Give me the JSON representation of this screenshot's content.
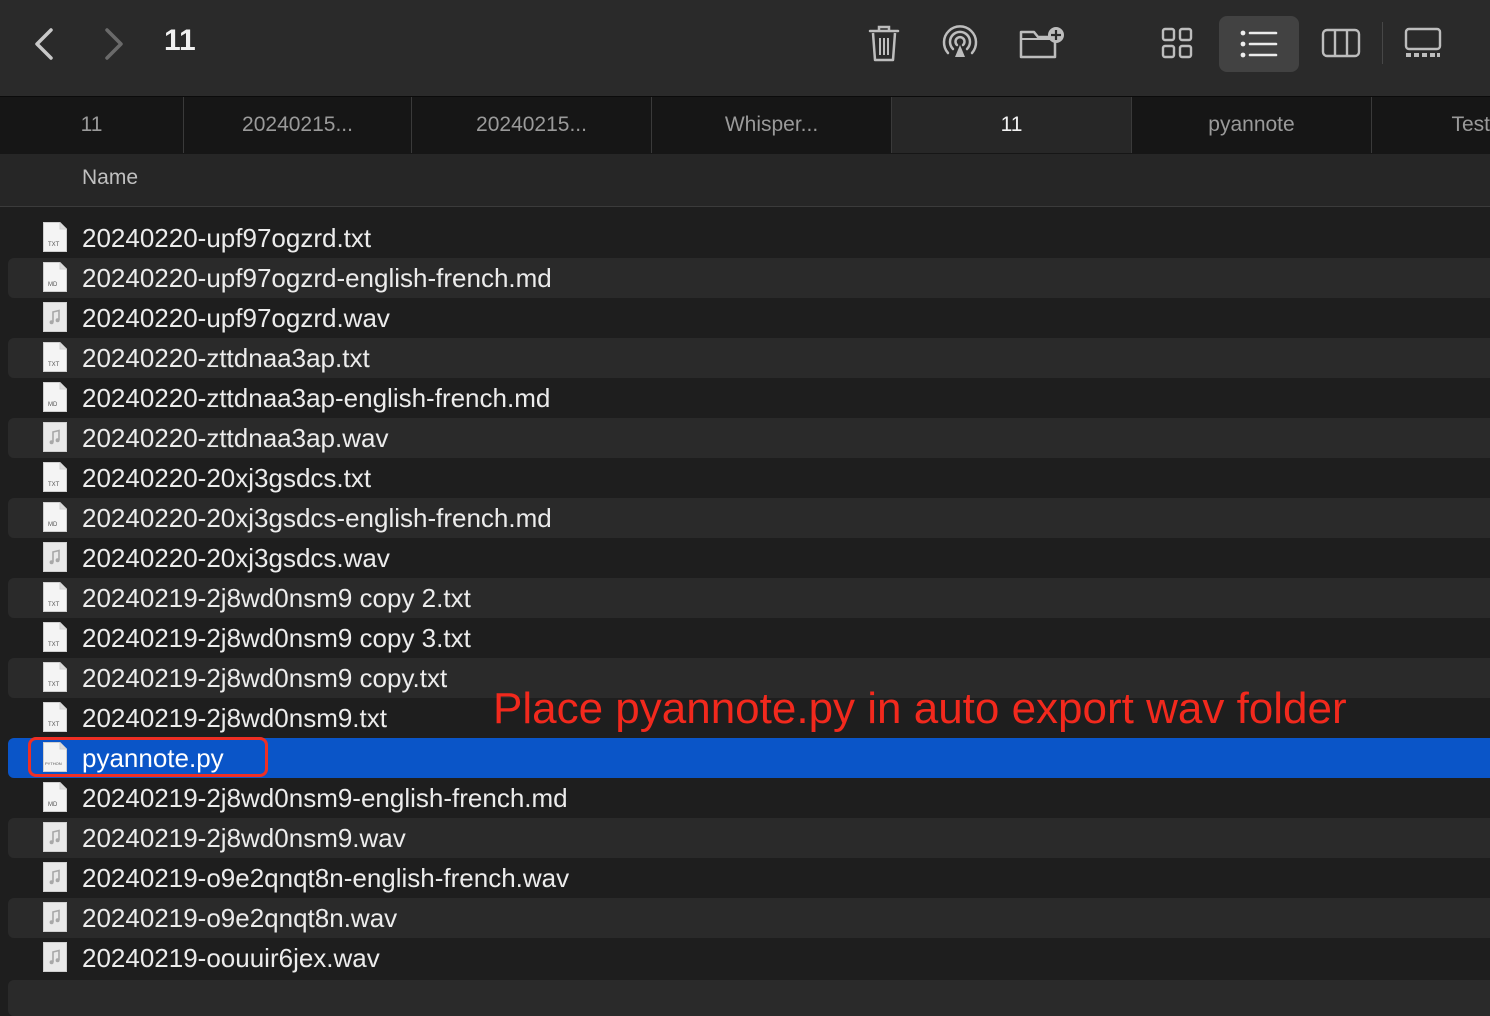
{
  "window": {
    "title": "11"
  },
  "toolbar": {
    "back_icon": "chevron-left-icon",
    "forward_icon": "chevron-right-icon",
    "trash_icon": "trash-icon",
    "airdrop_icon": "airdrop-icon",
    "new_folder_icon": "folder-plus-icon",
    "view_modes": [
      "icon-grid",
      "list",
      "columns",
      "gallery"
    ],
    "active_view": "list"
  },
  "tabs": [
    {
      "label": "11"
    },
    {
      "label": "20240215..."
    },
    {
      "label": "20240215..."
    },
    {
      "label": "Whisper..."
    },
    {
      "label": "11",
      "active": true
    },
    {
      "label": "pyannote"
    },
    {
      "label": "Test"
    }
  ],
  "columns": {
    "name": "Name"
  },
  "files": [
    {
      "name": "20240220-upf97ogzrd.txt",
      "type": "txt",
      "badge": "TXT"
    },
    {
      "name": "20240220-upf97ogzrd-english-french.md",
      "type": "md",
      "badge": "MD"
    },
    {
      "name": "20240220-upf97ogzrd.wav",
      "type": "wav",
      "badge": ""
    },
    {
      "name": "20240220-zttdnaa3ap.txt",
      "type": "txt",
      "badge": "TXT"
    },
    {
      "name": "20240220-zttdnaa3ap-english-french.md",
      "type": "md",
      "badge": "MD"
    },
    {
      "name": "20240220-zttdnaa3ap.wav",
      "type": "wav",
      "badge": ""
    },
    {
      "name": "20240220-20xj3gsdcs.txt",
      "type": "txt",
      "badge": "TXT"
    },
    {
      "name": "20240220-20xj3gsdcs-english-french.md",
      "type": "md",
      "badge": "MD"
    },
    {
      "name": "20240220-20xj3gsdcs.wav",
      "type": "wav",
      "badge": ""
    },
    {
      "name": "20240219-2j8wd0nsm9 copy 2.txt",
      "type": "txt",
      "badge": "TXT"
    },
    {
      "name": "20240219-2j8wd0nsm9 copy 3.txt",
      "type": "txt",
      "badge": "TXT"
    },
    {
      "name": "20240219-2j8wd0nsm9 copy.txt",
      "type": "txt",
      "badge": "TXT"
    },
    {
      "name": "20240219-2j8wd0nsm9.txt",
      "type": "txt",
      "badge": "TXT"
    },
    {
      "name": "pyannote.py",
      "type": "py",
      "badge": "PYTHON",
      "selected": true
    },
    {
      "name": "20240219-2j8wd0nsm9-english-french.md",
      "type": "md",
      "badge": "MD"
    },
    {
      "name": "20240219-2j8wd0nsm9.wav",
      "type": "wav",
      "badge": ""
    },
    {
      "name": "20240219-o9e2qnqt8n-english-french.wav",
      "type": "wav",
      "badge": ""
    },
    {
      "name": "20240219-o9e2qnqt8n.wav",
      "type": "wav",
      "badge": ""
    },
    {
      "name": "20240219-oouuir6jex.wav",
      "type": "wav",
      "badge": ""
    }
  ],
  "annotation": {
    "text": "Place pyannote.py in auto export wav folder",
    "color": "#f2291d"
  },
  "colors": {
    "selection": "#0a55c8",
    "annotation_box": "#ef2f24"
  }
}
